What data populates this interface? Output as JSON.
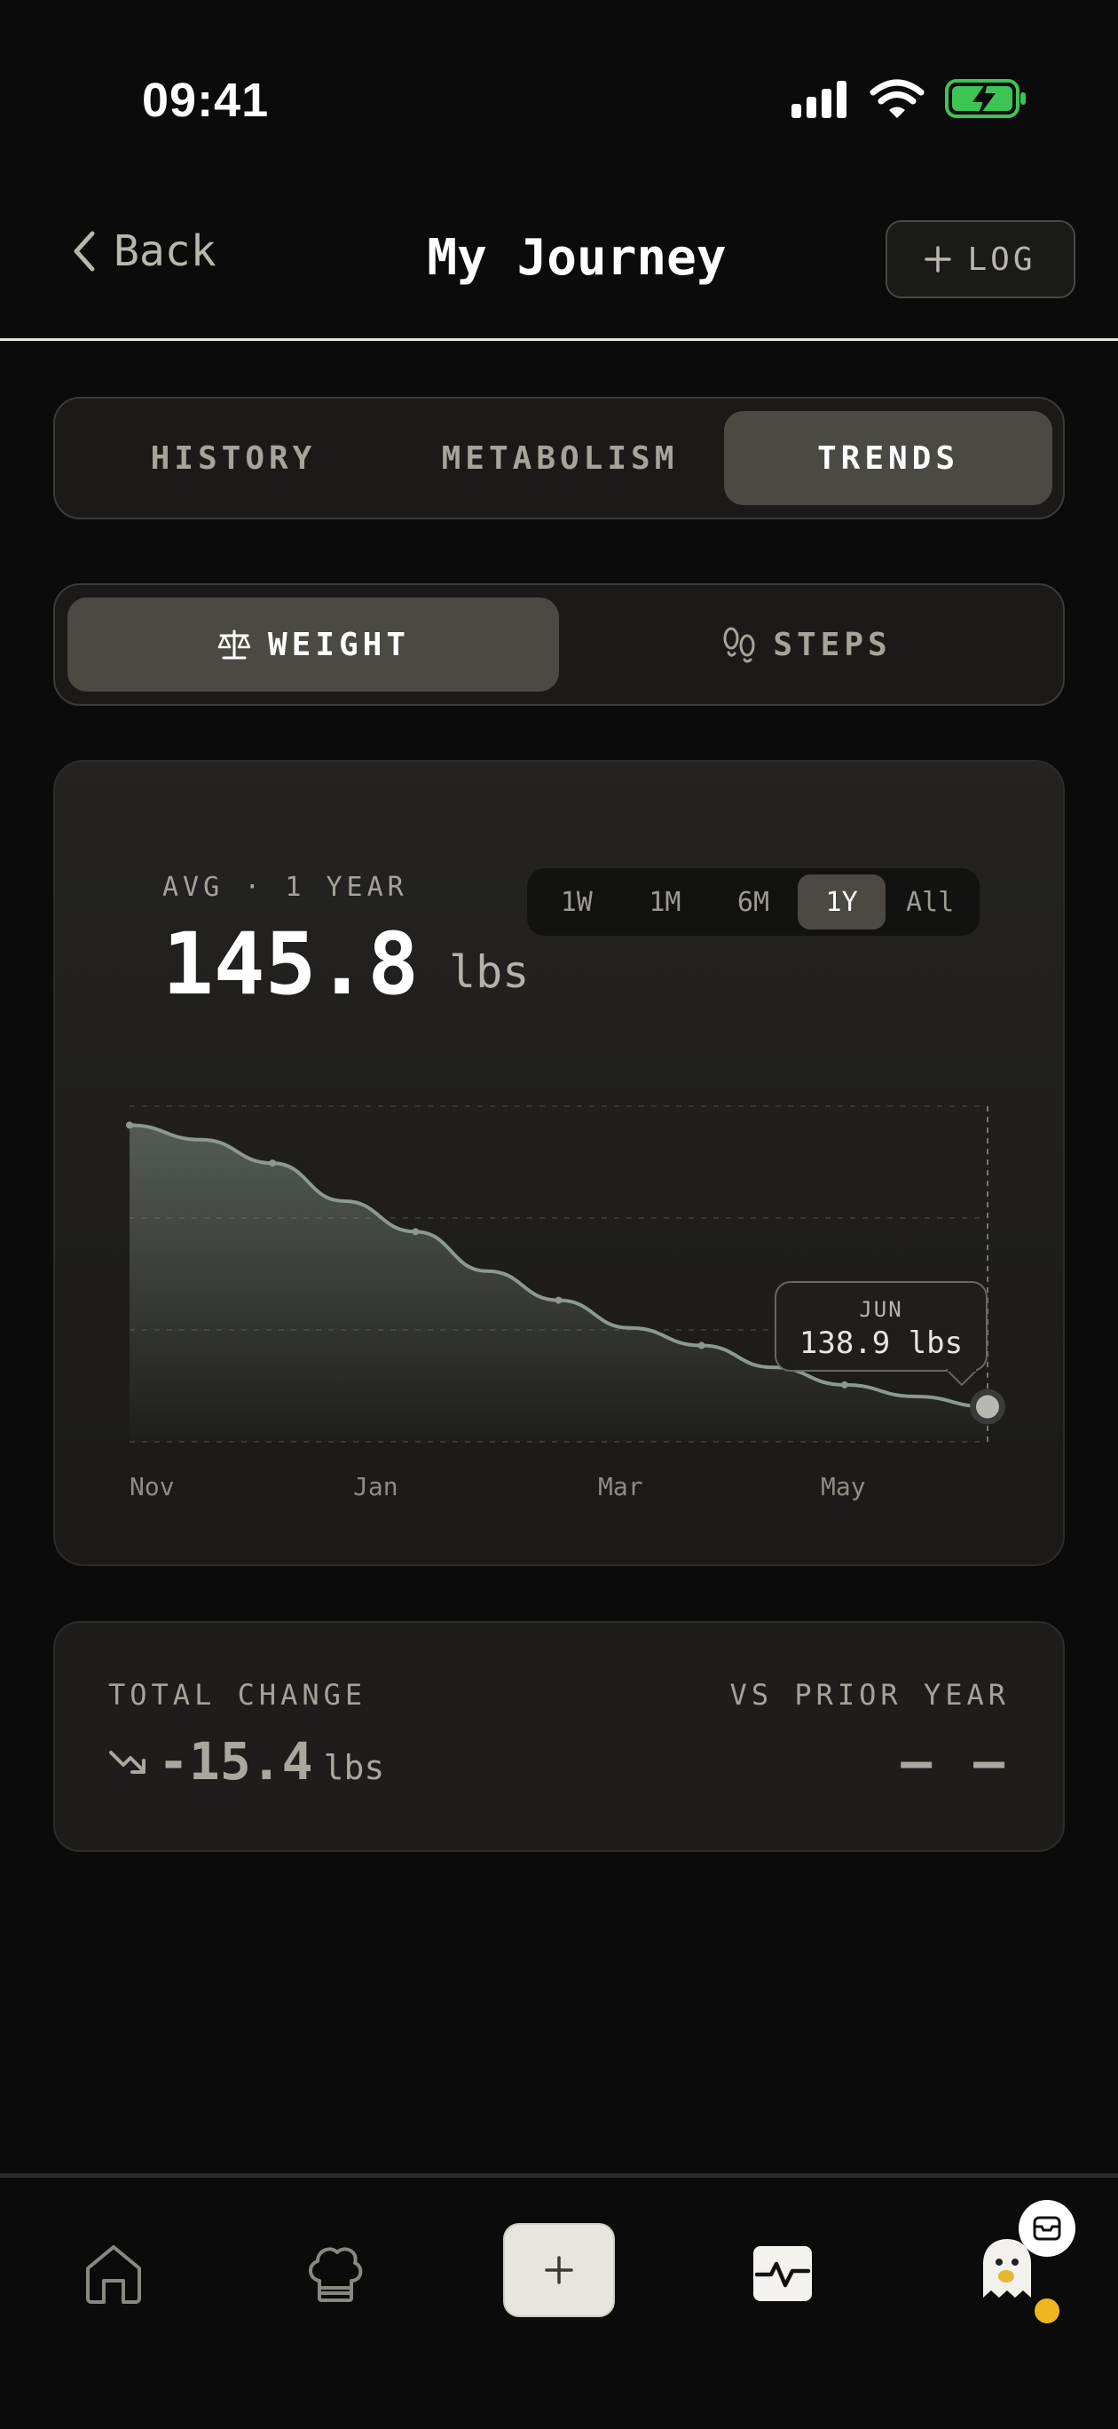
{
  "status_bar": {
    "time": "09:41"
  },
  "nav": {
    "back_label": "Back",
    "title": "My Journey",
    "log_label": "LOG"
  },
  "view_tabs": [
    {
      "label": "HISTORY",
      "active": false
    },
    {
      "label": "METABOLISM",
      "active": false
    },
    {
      "label": "TRENDS",
      "active": true
    }
  ],
  "metric_tabs": [
    {
      "label": "WEIGHT",
      "icon": "scale-icon",
      "active": true
    },
    {
      "label": "STEPS",
      "icon": "footprints-icon",
      "active": false
    }
  ],
  "summary": {
    "avg_label": "AVG · 1 YEAR",
    "avg_value": "145.8",
    "unit": "lbs"
  },
  "ranges": [
    "1W",
    "1M",
    "6M",
    "1Y",
    "All"
  ],
  "selected_range": "1Y",
  "chart_data": {
    "type": "area",
    "series": [
      {
        "values": [
          158.2,
          157.2,
          155.6,
          153.0,
          150.9,
          148.2,
          146.2,
          144.3,
          143.1,
          141.6,
          140.4,
          139.6,
          138.9
        ]
      }
    ],
    "x_tick_labels": [
      "Nov",
      "Jan",
      "Mar",
      "May"
    ],
    "ylim": [
      136.5,
      159.5
    ],
    "grid": true,
    "highlight": {
      "month": "JUN",
      "value": "138.9 lbs"
    }
  },
  "totals": {
    "total_change_label": "TOTAL CHANGE",
    "total_change_value": "-15.4",
    "total_change_unit": "lbs",
    "prior_label": "VS PRIOR YEAR",
    "prior_value": "— —"
  },
  "bottom_nav": [
    {
      "icon": "home-icon"
    },
    {
      "icon": "chef-hat-icon"
    },
    {
      "icon": "plus-icon"
    },
    {
      "icon": "activity-icon"
    },
    {
      "icon": "ghost-avatar-icon"
    }
  ]
}
